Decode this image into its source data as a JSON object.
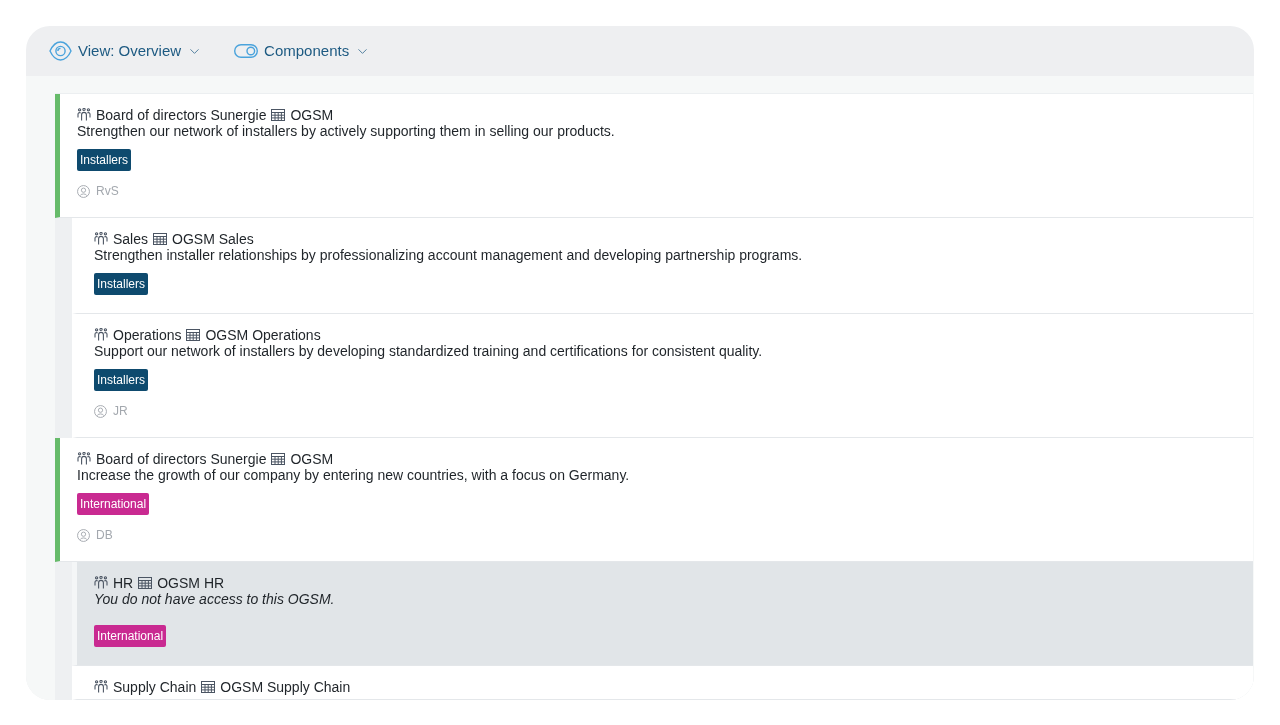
{
  "toolbar": {
    "view_menu": {
      "label": "View: Overview"
    },
    "components_menu": {
      "label": "Components"
    }
  },
  "items": [
    {
      "team": "Board of directors Sunergie",
      "ogsm": "OGSM",
      "description": "Strengthen our network of installers by actively supporting them in selling our products.",
      "restricted": false,
      "tag": {
        "label": "Installers",
        "color": "#0e4a6e"
      },
      "owner": "RvS",
      "children": [
        {
          "team": "Sales",
          "ogsm": "OGSM Sales",
          "description": "Strengthen installer relationships by professionalizing account management and developing partnership programs.",
          "restricted": false,
          "tag": {
            "label": "Installers",
            "color": "#0e4a6e"
          }
        },
        {
          "team": "Operations",
          "ogsm": "OGSM Operations",
          "description": "Support our network of installers by developing standardized training and certifications for consistent quality.",
          "restricted": false,
          "tag": {
            "label": "Installers",
            "color": "#0e4a6e"
          },
          "owner": "JR"
        }
      ]
    },
    {
      "team": "Board of directors Sunergie",
      "ogsm": "OGSM",
      "description": "Increase the growth of our company by entering new countries, with a focus on Germany.",
      "restricted": false,
      "tag": {
        "label": "International",
        "color": "#c92a91"
      },
      "owner": "DB",
      "children": [
        {
          "team": "HR",
          "ogsm": "OGSM HR",
          "description": "You do not have access to this OGSM.",
          "restricted": true,
          "tag": {
            "label": "International",
            "color": "#c92a91"
          }
        },
        {
          "team": "Supply Chain",
          "ogsm": "OGSM Supply Chain",
          "restricted": false
        }
      ]
    }
  ]
}
